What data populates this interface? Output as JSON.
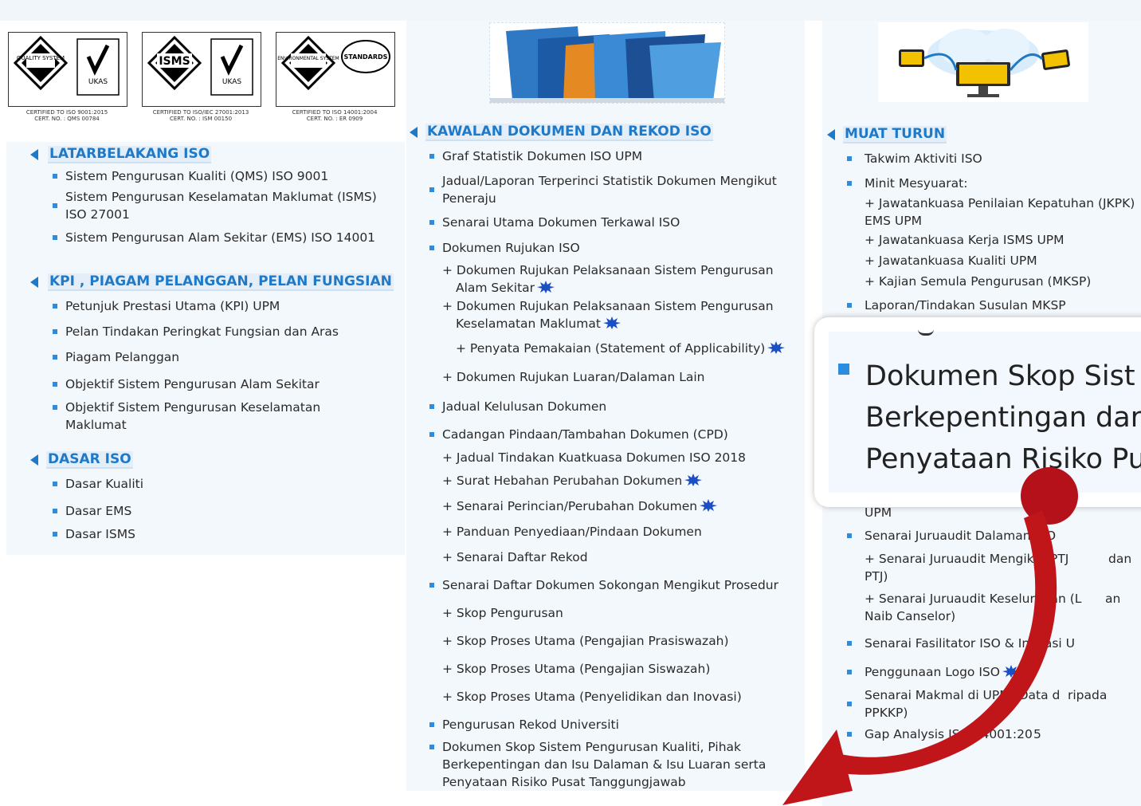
{
  "certs": [
    {
      "caption": "CERTIFIED TO ISO 9001:2015\nCERT. NO. : QMS 00784",
      "left_label": "QUALITY SYSTEM",
      "right_label": "UKAS"
    },
    {
      "caption": "CERTIFIED TO ISO/IEC 27001:2013\nCERT. NO. : ISM 00150",
      "left_label": "ISMS",
      "right_label": "UKAS"
    },
    {
      "caption": "CERTIFIED TO ISO 14001:2004\nCERT. NO. : ER 0909",
      "left_label": "ENVIRONMENTAL SYSTEM",
      "right_label": "STANDARDS"
    }
  ],
  "left": {
    "sections": [
      {
        "title": "LATARBELAKANG ISO",
        "items": [
          "Sistem Pengurusan Kualiti (QMS) ISO 9001",
          "Sistem Pengurusan Keselamatan Maklumat (ISMS) ISO 27001",
          "Sistem Pengurusan Alam Sekitar (EMS) ISO 14001"
        ]
      },
      {
        "title": "KPI , PIAGAM PELANGGAN, PELAN FUNGSIAN",
        "items": [
          "Petunjuk Prestasi Utama (KPI) UPM",
          "Pelan Tindakan Peringkat Fungsian dan Aras",
          "Piagam Pelanggan",
          "Objektif Sistem Pengurusan Alam Sekitar",
          "Objektif Sistem Pengurusan Keselamatan Maklumat"
        ]
      },
      {
        "title": "DASAR ISO",
        "items": [
          "Dasar Kualiti",
          "Dasar EMS",
          "Dasar ISMS"
        ]
      }
    ]
  },
  "middle": {
    "title": "KAWALAN DOKUMEN DAN REKOD ISO",
    "items": [
      "Graf Statistik Dokumen ISO UPM",
      "Jadual/Laporan Terperinci Statistik Dokumen Mengikut Peneraju",
      "Senarai Utama Dokumen Terkawal ISO",
      "Dokumen Rujukan ISO",
      "+ Dokumen Rujukan Pelaksanaan Sistem Pengurusan Alam Sekitar",
      "+ Dokumen Rujukan Pelaksanaan Sistem Pengurusan Keselamatan Maklumat",
      "+ Penyata Pemakaian (Statement of Applicability)",
      "+ Dokumen Rujukan Luaran/Dalaman Lain",
      "Jadual Kelulusan Dokumen",
      "Cadangan Pindaan/Tambahan Dokumen (CPD)",
      "+ Jadual Tindakan Kuatkuasa Dokumen ISO 2018",
      "+ Surat Hebahan Perubahan Dokumen",
      "+ Senarai Perincian/Perubahan Dokumen",
      "+ Panduan Penyediaan/Pindaan Dokumen",
      "+ Senarai Daftar Rekod",
      "Senarai Daftar Dokumen Sokongan Mengikut Prosedur",
      "+ Skop Pengurusan",
      "+ Skop Proses Utama (Pengajian Prasiswazah)",
      "+ Skop Proses Utama (Pengajian Siswazah)",
      "+ Skop Proses Utama (Penyelidikan dan Inovasi)",
      "Pengurusan Rekod Universiti",
      "Dokumen Skop Sistem Pengurusan Kualiti, Pihak Berkepentingan dan Isu Dalaman & Isu Luaran serta Penyataan Risiko Pusat Tanggungjawab"
    ]
  },
  "right": {
    "title": "MUAT TURUN",
    "items": [
      "Takwim Aktiviti ISO",
      "Minit Mesyuarat:",
      "+ Jawatankuasa Penilaian Kepatuhan (JKPK) EMS UPM",
      "+ Jawatankuasa Kerja ISMS UPM",
      "+ Jawatankuasa Kualiti UPM",
      "+ Kajian Semula Pengurusan (MKSP)",
      "Laporan/Tindakan Susulan MKSP",
      "UPM",
      "Senarai Juruaudit Dalaman ISO",
      "+ Senarai Juruaudit Mengikut PTJ",
      "dan",
      "PTJ)",
      "+ Senarai Juruaudit Keseluruhan (L",
      "an",
      "Naib Canselor)",
      "Senarai Fasilitator ISO & Inovasi U",
      "Penggunaan Logo ISO",
      "Senarai Makmal di UPM (Data d",
      "ripada",
      "PPKKP)",
      "Gap Analysis ISO 14001:20",
      "5"
    ]
  },
  "zoom": {
    "lines": [
      "Dokumen Skop Sist",
      "Berkepentingan dar",
      "Penyataan Risiko Pu"
    ]
  },
  "colors": {
    "accent": "#1e7ac8",
    "bullet": "#2a8de0",
    "arrow": "#c0161a",
    "panel": "#f3f8fc"
  },
  "icons": [
    "folders-banner",
    "cloud-devices-banner",
    "new-badge-icon",
    "red-curved-arrow"
  ]
}
